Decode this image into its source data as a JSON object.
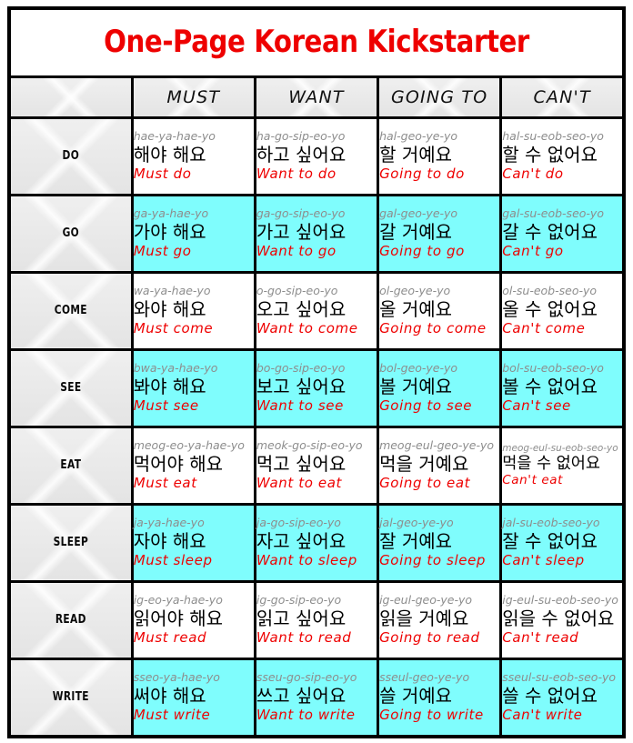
{
  "title": "One-Page Korean Kickstarter",
  "columns": [
    {
      "key": "corner",
      "label": ""
    },
    {
      "key": "must",
      "label": "MUST"
    },
    {
      "key": "want",
      "label": "WANT"
    },
    {
      "key": "going_to",
      "label": "GOING TO"
    },
    {
      "key": "cant",
      "label": "CAN'T"
    }
  ],
  "colors": {
    "title_red": "#ee0000",
    "english_red": "#ee0000",
    "romanization_gray": "#8d8d8d",
    "highlight_cyan": "#7ffdfd",
    "plain_white": "#ffffff",
    "label_gray": "#e8e8e8",
    "border_black": "#000000"
  },
  "rows": [
    {
      "verb": "DO",
      "highlight": false,
      "cells": [
        {
          "rom": "hae-ya-hae-yo",
          "kor": "해야 해요",
          "eng": "Must do"
        },
        {
          "rom": "ha-go-sip-eo-yo",
          "kor": "하고 싶어요",
          "eng": "Want to do"
        },
        {
          "rom": "hal-geo-ye-yo",
          "kor": "할 거예요",
          "eng": "Going to do"
        },
        {
          "rom": "hal-su-eob-seo-yo",
          "kor": "할 수 없어요",
          "eng": "Can't do"
        }
      ]
    },
    {
      "verb": "GO",
      "highlight": true,
      "cells": [
        {
          "rom": "ga-ya-hae-yo",
          "kor": "가야 해요",
          "eng": "Must go"
        },
        {
          "rom": "ga-go-sip-eo-yo",
          "kor": "가고 싶어요",
          "eng": "Want to go"
        },
        {
          "rom": "gal-geo-ye-yo",
          "kor": "갈 거예요",
          "eng": "Going to go"
        },
        {
          "rom": "gal-su-eob-seo-yo",
          "kor": "갈 수 없어요",
          "eng": "Can't go"
        }
      ]
    },
    {
      "verb": "COME",
      "highlight": false,
      "cells": [
        {
          "rom": "wa-ya-hae-yo",
          "kor": "와야 해요",
          "eng": "Must come"
        },
        {
          "rom": "o-go-sip-eo-yo",
          "kor": "오고 싶어요",
          "eng": "Want to come"
        },
        {
          "rom": "ol-geo-ye-yo",
          "kor": "올 거예요",
          "eng": "Going to come"
        },
        {
          "rom": "ol-su-eob-seo-yo",
          "kor": "올 수 없어요",
          "eng": "Can't come"
        }
      ]
    },
    {
      "verb": "SEE",
      "highlight": true,
      "cells": [
        {
          "rom": "bwa-ya-hae-yo",
          "kor": "봐야 해요",
          "eng": "Must see"
        },
        {
          "rom": "bo-go-sip-eo-yo",
          "kor": "보고 싶어요",
          "eng": "Want to see"
        },
        {
          "rom": "bol-geo-ye-yo",
          "kor": "볼 거예요",
          "eng": "Going to see"
        },
        {
          "rom": "bol-su-eob-seo-yo",
          "kor": "볼 수 없어요",
          "eng": "Can't see"
        }
      ]
    },
    {
      "verb": "EAT",
      "highlight": false,
      "cells": [
        {
          "rom": "meog-eo-ya-hae-yo",
          "kor": "먹어야 해요",
          "eng": "Must eat"
        },
        {
          "rom": "meok-go-sip-eo-yo",
          "kor": "먹고 싶어요",
          "eng": "Want to eat"
        },
        {
          "rom": "meog-eul-geo-ye-yo",
          "kor": "먹을 거예요",
          "eng": "Going to eat"
        },
        {
          "rom": "meog-eul-su-eob-seo-yo",
          "kor": "먹을 수 없어요",
          "eng": "Can't eat",
          "rom_small": true,
          "kor_small": true,
          "eng_small": true
        }
      ]
    },
    {
      "verb": "SLEEP",
      "highlight": true,
      "cells": [
        {
          "rom": "ja-ya-hae-yo",
          "kor": "자야 해요",
          "eng": "Must sleep"
        },
        {
          "rom": "ja-go-sip-eo-yo",
          "kor": "자고 싶어요",
          "eng": "Want to sleep"
        },
        {
          "rom": "jal-geo-ye-yo",
          "kor": "잘 거예요",
          "eng": "Going to sleep"
        },
        {
          "rom": "jal-su-eob-seo-yo",
          "kor": "잘 수 없어요",
          "eng": "Can't sleep"
        }
      ]
    },
    {
      "verb": "READ",
      "highlight": false,
      "cells": [
        {
          "rom": "ig-eo-ya-hae-yo",
          "kor": "읽어야 해요",
          "eng": "Must read"
        },
        {
          "rom": "ig-go-sip-eo-yo",
          "kor": "읽고 싶어요",
          "eng": "Want to read"
        },
        {
          "rom": "ig-eul-geo-ye-yo",
          "kor": "읽을 거예요",
          "eng": "Going to read"
        },
        {
          "rom": "ig-eul-su-eob-seo-yo",
          "kor": "읽을 수 없어요",
          "eng": "Can't read",
          "rom_wrap": true
        }
      ]
    },
    {
      "verb": "WRITE",
      "highlight": true,
      "cells": [
        {
          "rom": "sseo-ya-hae-yo",
          "kor": "써야 해요",
          "eng": "Must write"
        },
        {
          "rom": "sseu-go-sip-eo-yo",
          "kor": "쓰고 싶어요",
          "eng": "Want to write"
        },
        {
          "rom": "sseul-geo-ye-yo",
          "kor": "쓸 거예요",
          "eng": "Going to write"
        },
        {
          "rom": "sseul-su-eob-seo-yo",
          "kor": "쓸 수 없어요",
          "eng": "Can't write"
        }
      ]
    }
  ]
}
